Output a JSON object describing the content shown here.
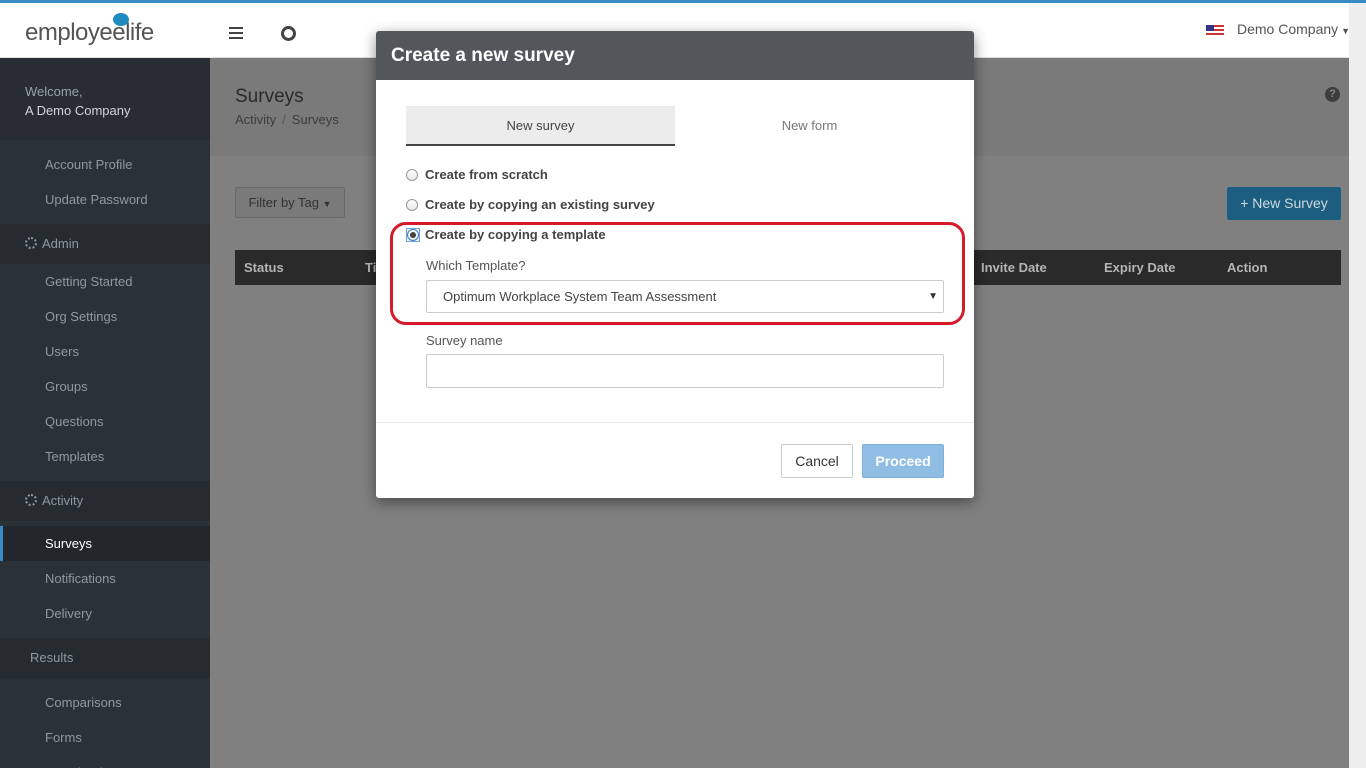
{
  "header": {
    "logo_text": "employeelife",
    "company": "Demo Company"
  },
  "sidebar": {
    "welcome": "Welcome,",
    "user": "A Demo Company",
    "items": [
      {
        "type": "sub",
        "label": "Account Profile"
      },
      {
        "type": "sub",
        "label": "Update Password"
      },
      {
        "type": "head",
        "label": "Admin",
        "icon": "gear-icon"
      },
      {
        "type": "sub",
        "label": "Getting Started"
      },
      {
        "type": "sub",
        "label": "Org Settings"
      },
      {
        "type": "sub",
        "label": "Users"
      },
      {
        "type": "sub",
        "label": "Groups"
      },
      {
        "type": "sub",
        "label": "Questions"
      },
      {
        "type": "sub",
        "label": "Templates"
      },
      {
        "type": "head",
        "label": "Activity",
        "icon": "gear-icon"
      },
      {
        "type": "sub",
        "label": "Surveys",
        "active": true
      },
      {
        "type": "sub",
        "label": "Notifications"
      },
      {
        "type": "sub",
        "label": "Delivery"
      },
      {
        "type": "head",
        "label": "Results"
      },
      {
        "type": "sub",
        "label": "Comparisons"
      },
      {
        "type": "sub",
        "label": "Forms"
      },
      {
        "type": "sub",
        "label": "Downloads"
      }
    ]
  },
  "page": {
    "title": "Surveys",
    "breadcrumb": [
      "Activity",
      "Surveys"
    ],
    "filter_label": "Filter by Tag",
    "new_survey_label": "+ New Survey",
    "help_glyph": "?",
    "table_headers": {
      "status": "Status",
      "title_partial": "Ti",
      "invite_date": "Invite Date",
      "expiry_date": "Expiry Date",
      "action": "Action"
    }
  },
  "modal": {
    "title": "Create a new survey",
    "tabs": [
      "New survey",
      "New form"
    ],
    "options": [
      {
        "label": "Create from scratch",
        "checked": false
      },
      {
        "label": "Create by copying an existing survey",
        "checked": false
      },
      {
        "label": "Create by copying a template",
        "checked": true
      }
    ],
    "template_label": "Which Template?",
    "template_value": "Optimum Workplace System Team Assessment",
    "survey_name_label": "Survey name",
    "survey_name_value": "",
    "cancel_label": "Cancel",
    "proceed_label": "Proceed"
  },
  "colors": {
    "accent": "#3a8bc8",
    "highlight": "#d61a2a",
    "proceed": "#8fbde4"
  }
}
